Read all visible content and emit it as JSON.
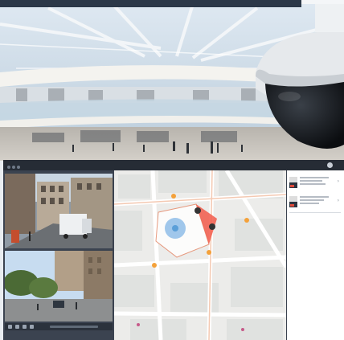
{
  "scene": {
    "description_colors": {
      "sky": "#cfe0ee",
      "floor": "#c9c4bd",
      "balcony": "#f2f2ef",
      "camera_body": "#e9ecef",
      "camera_dome": "#111418"
    }
  },
  "vms": {
    "header_title": "",
    "header_left": "",
    "colors": {
      "header": "#262c35",
      "panel": "#3b4350",
      "alert_zone": "#f25a4a",
      "map_circle": "#8fbde8"
    }
  },
  "cameras": [
    {
      "label": ""
    },
    {
      "label": ""
    }
  ],
  "events": [
    {
      "icon": "camera-icon",
      "alert": true
    },
    {
      "icon": "camera-icon",
      "alert": true
    }
  ]
}
